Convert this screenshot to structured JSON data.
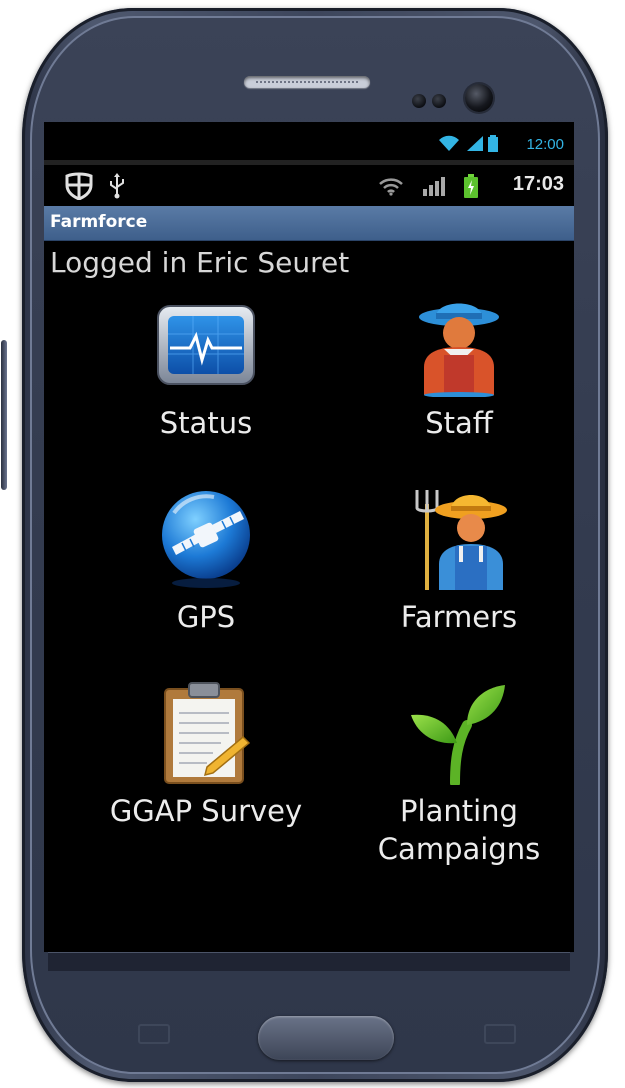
{
  "emulator_status": {
    "time": "12:00"
  },
  "device_status": {
    "time": "17:03"
  },
  "app": {
    "title": "Farmforce"
  },
  "session": {
    "logged_in_text": "Logged in Eric Seuret"
  },
  "menu": {
    "status": {
      "label": "Status",
      "icon": "monitor-heartbeat-icon"
    },
    "staff": {
      "label": "Staff",
      "icon": "staff-person-icon"
    },
    "gps": {
      "label": "GPS",
      "icon": "satellite-globe-icon"
    },
    "farmers": {
      "label": "Farmers",
      "icon": "farmer-pitchfork-icon"
    },
    "ggap_survey": {
      "label": "GGAP Survey",
      "icon": "clipboard-icon"
    },
    "planting_campaigns": {
      "label": "Planting\nCampaigns",
      "icon": "seedling-icon"
    }
  },
  "colors": {
    "title_bar": "#4a6b97",
    "emulator_accent": "#33b5e5",
    "screen_background": "#000000"
  }
}
